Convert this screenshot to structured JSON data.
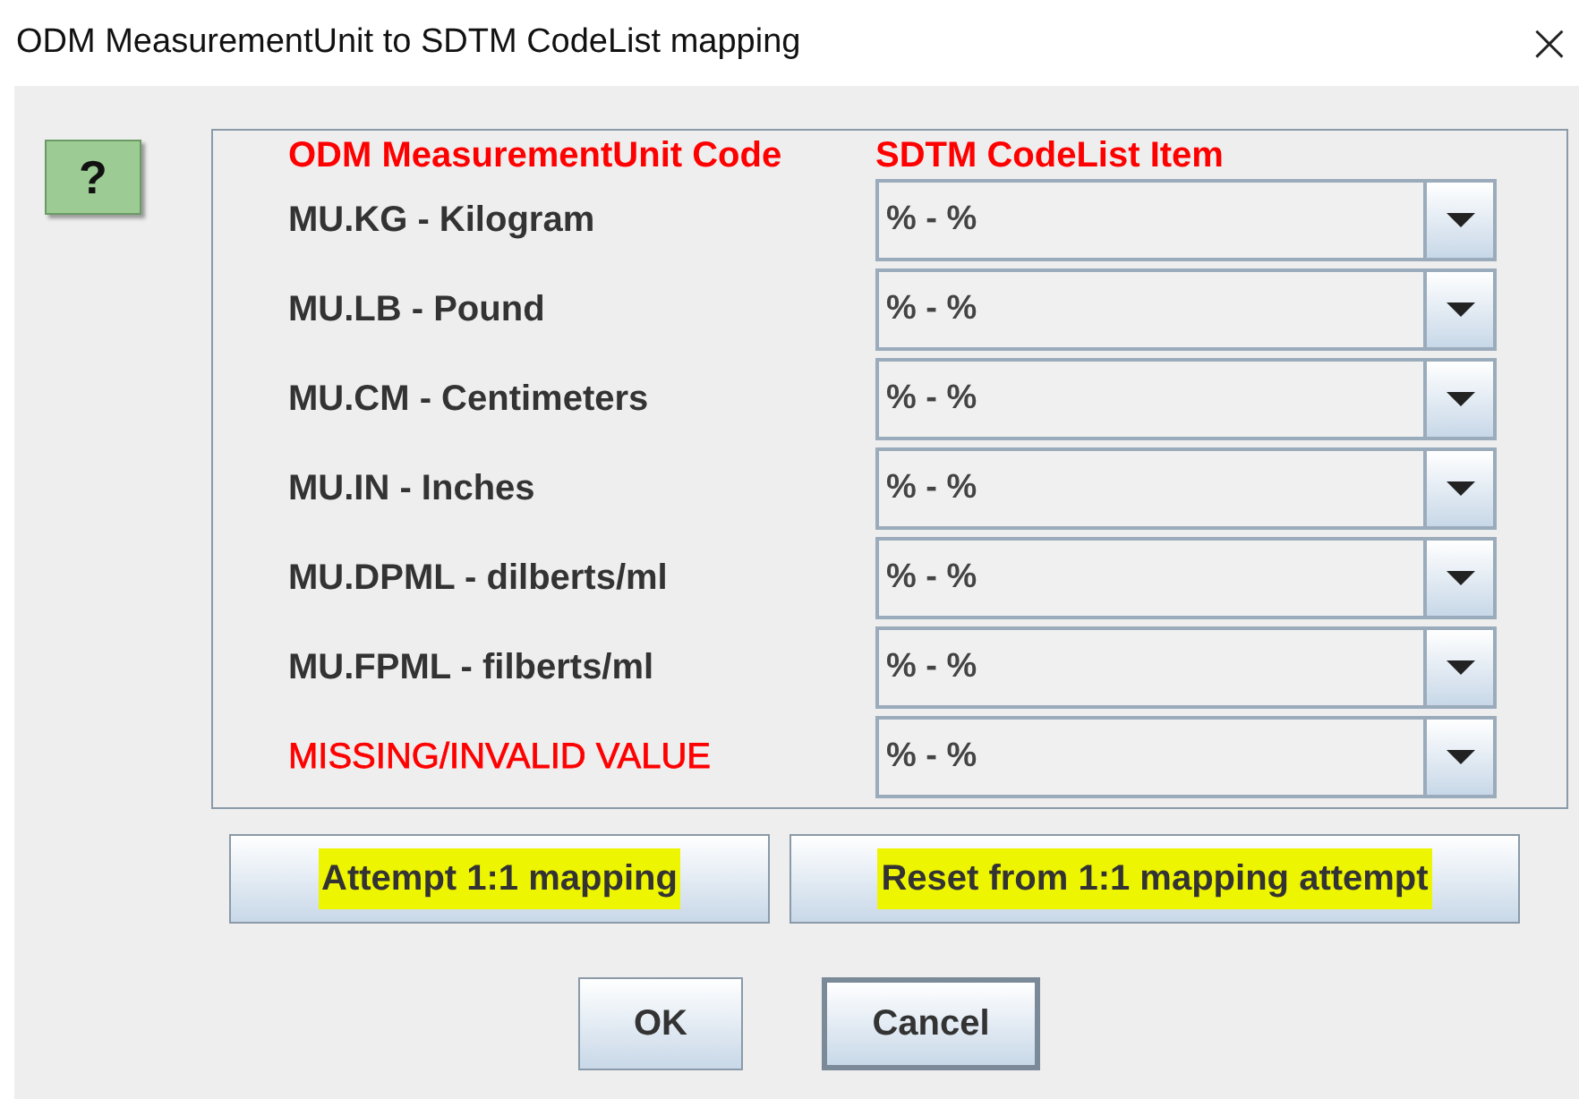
{
  "window": {
    "title": "ODM MeasurementUnit to SDTM CodeList mapping",
    "close": "×"
  },
  "help_button": "?",
  "table": {
    "columns": [
      "ODM MeasurementUnit Code",
      "SDTM CodeList Item"
    ],
    "rows": [
      {
        "kind": "unit",
        "label": "MU.KG - Kilogram",
        "value": "% - %"
      },
      {
        "kind": "unit",
        "label": "MU.LB - Pound",
        "value": "% - %"
      },
      {
        "kind": "unit",
        "label": "MU.CM - Centimeters",
        "value": "% - %"
      },
      {
        "kind": "unit",
        "label": "MU.IN - Inches",
        "value": "% - %"
      },
      {
        "kind": "unit",
        "label": "MU.DPML - dilberts/ml",
        "value": "% - %"
      },
      {
        "kind": "unit",
        "label": "MU.FPML - filberts/ml",
        "value": "% - %"
      },
      {
        "kind": "missing",
        "label": "MISSING/INVALID VALUE",
        "value": "% - %"
      }
    ]
  },
  "action_buttons": [
    {
      "label": "Attempt 1:1 mapping",
      "highlighted": true
    },
    {
      "label": "Reset from 1:1 mapping attempt",
      "highlighted": true
    }
  ],
  "dialog_buttons": [
    {
      "label": "OK",
      "selected": false
    },
    {
      "label": "Cancel",
      "selected": true
    }
  ]
}
